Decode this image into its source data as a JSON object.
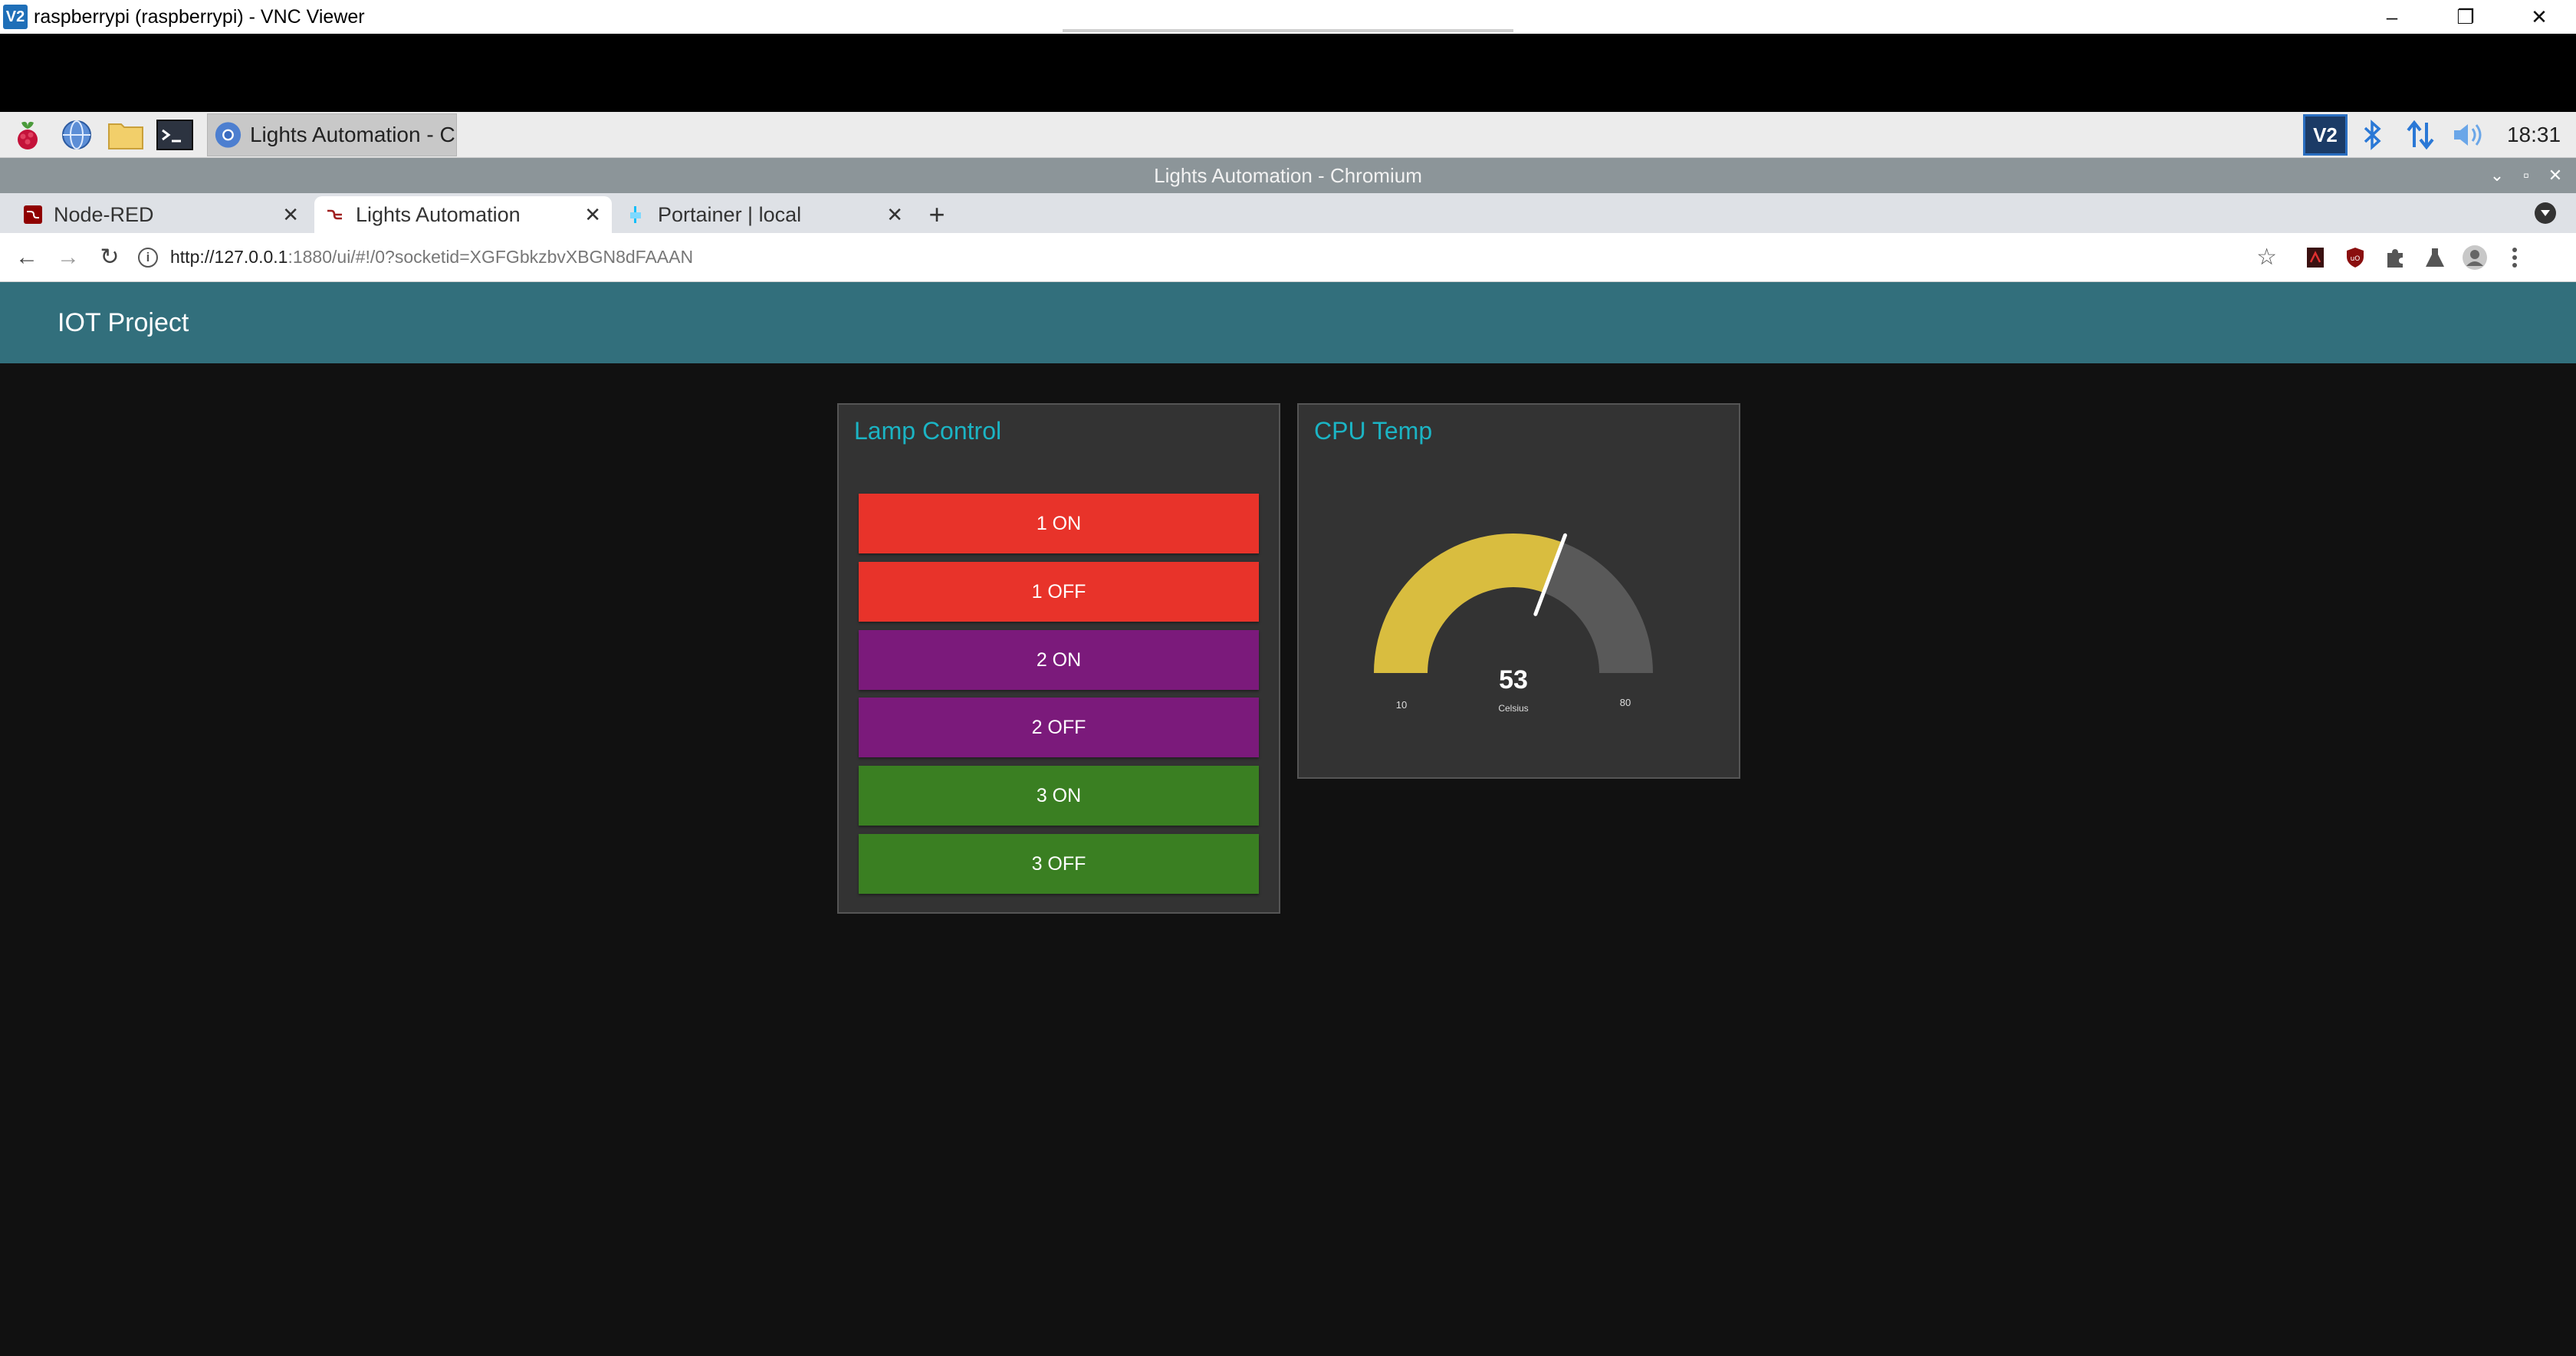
{
  "vnc": {
    "logo": "V2",
    "title": "raspberrypi (raspberrypi) - VNC Viewer",
    "controls": [
      "–",
      "❐",
      "✕"
    ]
  },
  "taskbar": {
    "task_label": "Lights Automation - C...",
    "clock": "18:31",
    "tray_vnc": "V2"
  },
  "chromium": {
    "window_title": "Lights Automation - Chromium",
    "tabs": [
      {
        "label": "Node-RED"
      },
      {
        "label": "Lights Automation"
      },
      {
        "label": "Portainer | local"
      }
    ],
    "url_host": "http://127.0.0.1",
    "url_rest": ":1880/ui/#!/0?socketid=XGFGbkzbvXBGN8dFAAAN"
  },
  "dashboard": {
    "title": "IOT Project",
    "lamp_control": {
      "title": "Lamp Control",
      "buttons": [
        {
          "label": "1 ON",
          "color": "#e8332a"
        },
        {
          "label": "1 OFF",
          "color": "#e8332a"
        },
        {
          "label": "2 ON",
          "color": "#7b1a7b"
        },
        {
          "label": "2 OFF",
          "color": "#7b1a7b"
        },
        {
          "label": "3 ON",
          "color": "#3a7f22"
        },
        {
          "label": "3 OFF",
          "color": "#3a7f22"
        }
      ]
    },
    "cpu_temp": {
      "title": "CPU Temp",
      "value": "53",
      "units": "Celsius",
      "min": "10",
      "max": "80",
      "fill_color": "#d9bd3f",
      "track_color": "#595959"
    }
  },
  "colors": {
    "header": "#326f7c",
    "card_title": "#1bb4c4",
    "background": "#111111"
  }
}
